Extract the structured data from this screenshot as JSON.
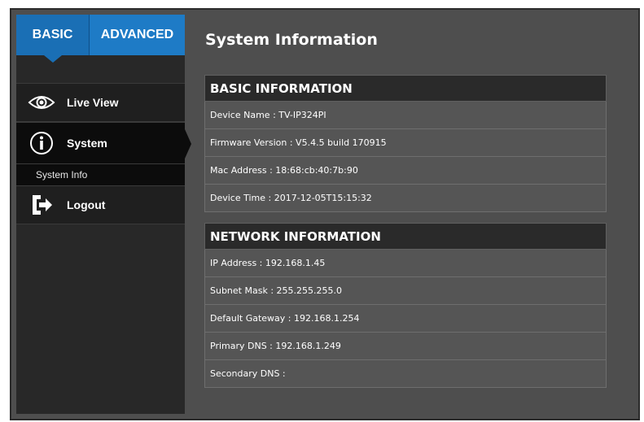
{
  "tabs": {
    "basic": "BASIC",
    "advanced": "ADVANCED"
  },
  "nav": {
    "live_view": "Live View",
    "system": "System",
    "system_info": "System Info",
    "logout": "Logout"
  },
  "page": {
    "title": "System Information"
  },
  "basic_info": {
    "header": "BASIC INFORMATION",
    "device_name": "Device Name : TV-IP324PI",
    "firmware": "Firmware Version : V5.4.5 build 170915",
    "mac": "Mac Address : 18:68:cb:40:7b:90",
    "device_time": "Device Time : 2017-12-05T15:15:32"
  },
  "network_info": {
    "header": "NETWORK INFORMATION",
    "ip": "IP Address : 192.168.1.45",
    "subnet": "Subnet Mask : 255.255.255.0",
    "gateway": "Default Gateway : 192.168.1.254",
    "primary_dns": "Primary DNS : 192.168.1.249",
    "secondary_dns": "Secondary DNS :"
  },
  "colors": {
    "accent": "#1a6fb5",
    "panel": "#4e4e4e",
    "sidebar": "#282828"
  },
  "icons": {
    "live_view": "eye-icon",
    "system": "info-icon",
    "logout": "logout-icon"
  }
}
